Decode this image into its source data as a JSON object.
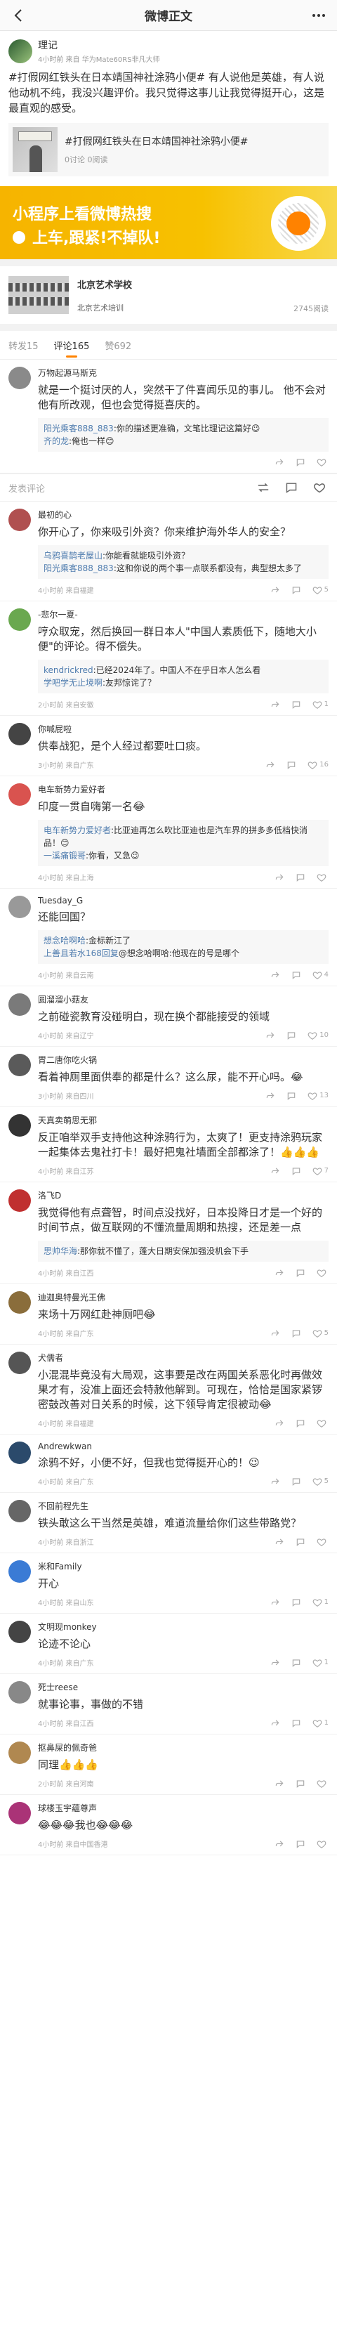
{
  "nav": {
    "title": "微博正文"
  },
  "post": {
    "author": "理记",
    "meta": "4小时前 来自 华为Mate60RS非凡大师",
    "text": "#打假网红铁头在日本靖国神社涂鸦小便# 有人说他是英雄，有人说他动机不纯，我没兴趣评价。我只觉得这事儿让我觉得挺开心，这是最直观的感受。",
    "topic": {
      "title": "#打假网红铁头在日本靖国神社涂鸦小便#",
      "meta": "0讨论 0阅读"
    }
  },
  "ad": {
    "line1": "小程序上看微博热搜",
    "line2": "上车,跟紧!不掉队!"
  },
  "sponsor": {
    "name": "北京艺术学校",
    "sub": "北京艺术培训",
    "views": "2745阅读"
  },
  "tabs": [
    {
      "label": "转发15"
    },
    {
      "label": "评论165"
    },
    {
      "label": "赞692"
    }
  ],
  "compose": {
    "placeholder": "发表评论"
  },
  "comments": [
    {
      "name": "万物起源马斯克",
      "text": "就是一个挺讨厌的人，突然干了件喜闻乐见的事儿。 他不会对他有所改观，但也会觉得挺喜庆的。",
      "replies": [
        {
          "n": "阳光乘客888_883",
          "t": ":你的描述更准确，文笔比理记这篇好😉"
        },
        {
          "n": "齐的龙",
          "t": ":俺也一样😊"
        }
      ],
      "time": "",
      "likes": "",
      "color": "#8a8a8a"
    },
    {
      "name": "最初的心",
      "text": "你开心了，你来吸引外资？你来维护海外华人的安全？",
      "replies": [
        {
          "n": "乌鸦喜鹊老屋山",
          "t": ":你能看就能吸引外资？"
        },
        {
          "n": "阳光乘客888_883",
          "t": ":这和你说的两个事一点联系都没有，典型想太多了"
        }
      ],
      "time": "4小时前 来自福建",
      "likes": "5",
      "color": "#b05050"
    },
    {
      "name": "-悲尔一夏-",
      "text": "哼众取宠，然后换回一群日本人\"中国人素质低下，随地大小便\"的评论。得不偿失。",
      "replies": [
        {
          "n": "kendrickred",
          "t": ":已经2024年了。中国人不在乎日本人怎么看"
        },
        {
          "n": "学吧学无止境啊",
          "t": ":友邦惊诧了？"
        }
      ],
      "time": "2小时前 来自安徽",
      "likes": "1",
      "color": "#6aa84f"
    },
    {
      "name": "你喊屁啦",
      "text": "供奉战犯，是个人经过都要吐口痰。",
      "replies": [],
      "time": "3小时前 来自广东",
      "likes": "16",
      "color": "#444"
    },
    {
      "name": "电车新势力爱好者",
      "text": "印度一贯自嗨第一名😂",
      "replies": [
        {
          "n": "电车新势力爱好者",
          "t": ":比亚迪再怎么吹比亚迪也是汽车界的拼多多低档快消品！😊"
        },
        {
          "n": "一溪痛锻哥",
          "t": ":你看，又急😉"
        }
      ],
      "time": "4小时前 来自上海",
      "likes": "",
      "color": "#d9534f"
    },
    {
      "name": "Tuesday_G",
      "text": "还能回国？",
      "replies": [
        {
          "n": "想念哈啊哈",
          "t": ":金标新江了"
        },
        {
          "n": "上善且若水168回复",
          "t": "@想念哈啊哈:他现在的号是哪个"
        }
      ],
      "time": "4小时前 来自云南",
      "likes": "4",
      "color": "#999"
    },
    {
      "name": "圆溜溜小菇友",
      "text": "之前碰瓷教育没碰明白，现在换个都能接受的领域",
      "replies": [],
      "time": "4小时前 来自辽宁",
      "likes": "10",
      "color": "#7a7a7a"
    },
    {
      "name": "胃二唐你吃火锅",
      "text": "看着神厕里面供奉的都是什么？这么尿，能不开心吗。😂",
      "replies": [],
      "time": "3小时前 来自四川",
      "likes": "13",
      "color": "#5a5a5a"
    },
    {
      "name": "天真卖萌思无邪",
      "text": "反正咱举双手支持他这种涂鸦行为，太爽了！更支持涂鸦玩家一起集体去鬼社打卡！最好把鬼社墙面全部都涂了！👍👍👍",
      "replies": [],
      "time": "4小时前 来自江苏",
      "likes": "7",
      "color": "#333"
    },
    {
      "name": "洛飞D",
      "text": "我觉得他有点聋智，时间点没找好，日本投降日才是一个好的时间节点，做互联网的不懂流量周期和热搜，还是差一点",
      "replies": [
        {
          "n": "思帅华海",
          "t": ":那你就不懂了，蓬大日期安保加强没机会下手"
        }
      ],
      "time": "4小时前 来自江西",
      "likes": "",
      "color": "#c03030"
    },
    {
      "name": "迪迦奥特曼光王佛",
      "text": "来场十万网红赴神厕吧😂",
      "replies": [],
      "time": "4小时前 来自广东",
      "likes": "5",
      "color": "#8a6d3b"
    },
    {
      "name": "犬儒者",
      "text": "小混混毕竟没有大局观，这事要是改在两国关系恶化时再做效果才有，没准上面还会特赦他解到。可现在，恰恰是国家紧锣密鼓改善对日关系的时候，这下领导肯定很被动😂",
      "replies": [],
      "time": "4小时前 来自福建",
      "likes": "",
      "color": "#555"
    },
    {
      "name": "Andrewkwan",
      "text": "涂鸦不好，小便不好，但我也觉得挺开心的！😉",
      "replies": [],
      "time": "4小时前 来自广东",
      "likes": "5",
      "color": "#2b4a6b"
    },
    {
      "name": "不回前程先生",
      "text": "铁头敢这么干当然是英雄，难道流量给你们这些带路党？",
      "replies": [],
      "time": "4小时前 来自浙江",
      "likes": "",
      "color": "#666"
    },
    {
      "name": "米和Family",
      "text": "开心",
      "replies": [],
      "time": "4小时前 来自山东",
      "likes": "1",
      "color": "#3a7bd5"
    },
    {
      "name": "文明现monkey",
      "text": "论迹不论心",
      "replies": [],
      "time": "4小时前 来自广东",
      "likes": "1",
      "color": "#444"
    },
    {
      "name": "死士reese",
      "text": "就事论事，事做的不错",
      "replies": [],
      "time": "4小时前 来自江西",
      "likes": "1",
      "color": "#888"
    },
    {
      "name": "抠鼻屎的佩奇爸",
      "text": "同理👍👍👍",
      "replies": [],
      "time": "2小时前 来自河南",
      "likes": "",
      "color": "#b08850"
    },
    {
      "name": "球楼玉宇蘊尊声",
      "text": "😂😂😂我也😂😂😂",
      "replies": [],
      "time": "4小时前 来自中国香港",
      "likes": "",
      "color": "#aa3377"
    }
  ],
  "colors": {
    "accent": "#ff8200",
    "link": "#507daf",
    "adYellow": "#f6b400"
  }
}
